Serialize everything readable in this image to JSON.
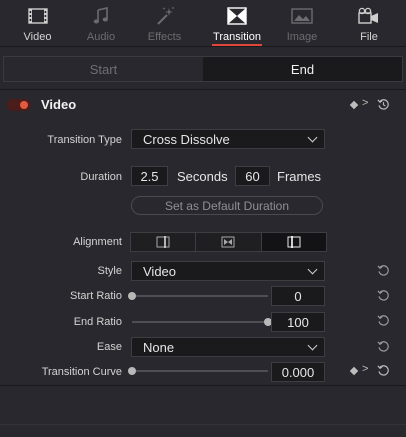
{
  "tabs": [
    {
      "label": "Video",
      "icon": "film-strip-icon",
      "state": "normal"
    },
    {
      "label": "Audio",
      "icon": "music-note-icon",
      "state": "dim"
    },
    {
      "label": "Effects",
      "icon": "magic-wand-icon",
      "state": "dim"
    },
    {
      "label": "Transition",
      "icon": "transition-icon",
      "state": "active"
    },
    {
      "label": "Image",
      "icon": "image-icon",
      "state": "dim"
    },
    {
      "label": "File",
      "icon": "file-icon",
      "state": "normal"
    }
  ],
  "segment": {
    "start": "Start",
    "end": "End",
    "selected": "End"
  },
  "section": {
    "title": "Video",
    "enabled": true
  },
  "fields": {
    "transition_type_label": "Transition Type",
    "transition_type_value": "Cross Dissolve",
    "duration_label": "Duration",
    "duration_seconds": "2.5",
    "seconds_unit": "Seconds",
    "duration_frames": "60",
    "frames_unit": "Frames",
    "set_default_label": "Set as Default Duration",
    "alignment_label": "Alignment",
    "style_label": "Style",
    "style_value": "Video",
    "start_ratio_label": "Start Ratio",
    "start_ratio_value": "0",
    "start_ratio_fraction": 0.0,
    "end_ratio_label": "End Ratio",
    "end_ratio_value": "100",
    "end_ratio_fraction": 1.0,
    "ease_label": "Ease",
    "ease_value": "None",
    "curve_label": "Transition Curve",
    "curve_value": "0.000",
    "curve_fraction": 0.0
  },
  "colors": {
    "accent": "#e0473a",
    "toggle_on": "#e55a3e"
  }
}
